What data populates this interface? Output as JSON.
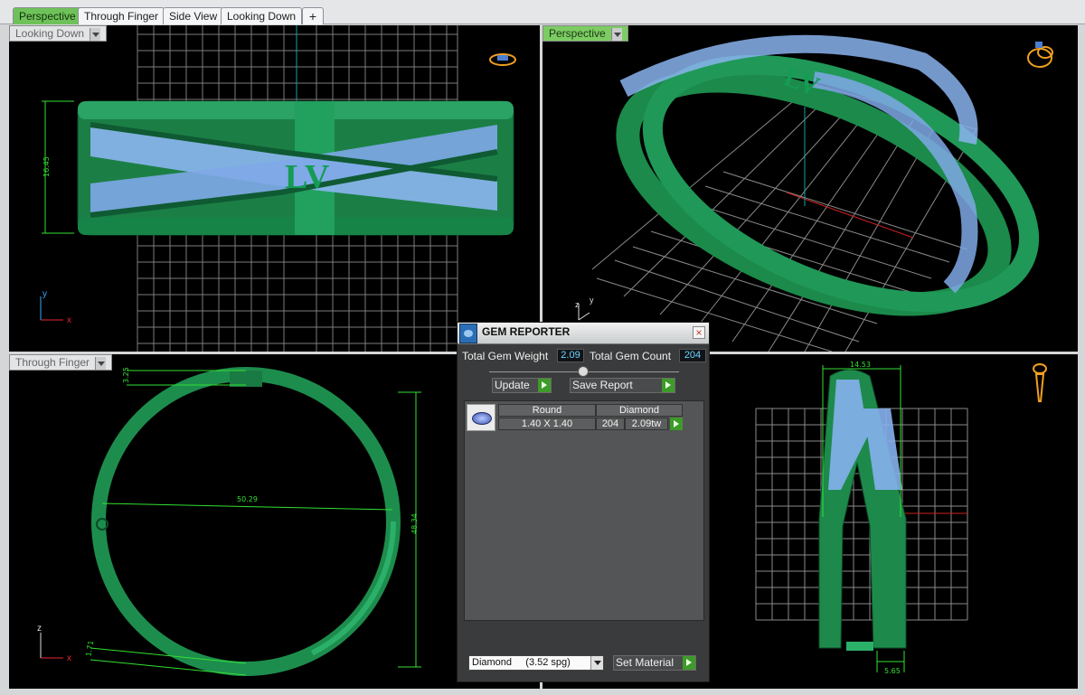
{
  "tabs": [
    {
      "label": "Perspective",
      "active": true
    },
    {
      "label": "Through Finger",
      "active": false
    },
    {
      "label": "Side View",
      "active": false
    },
    {
      "label": "Looking Down",
      "active": false
    }
  ],
  "add_tab_glyph": "+",
  "viewports": {
    "top_left": {
      "label": "Looking Down",
      "dimension": "16.45",
      "axis_x": "x",
      "axis_y": "y"
    },
    "top_right": {
      "label": "Perspective",
      "axis_z": "z",
      "axis_y": "y"
    },
    "bottom_left": {
      "label": "Through Finger",
      "dim_inner": "50.29",
      "dim_outer": "48.34",
      "dim_top": "3.25",
      "dim_bottom": "1.71",
      "axis_x": "x",
      "axis_z": "z"
    },
    "bottom_right": {
      "dim_top": "14.53",
      "dim_bottom": "5.65"
    }
  },
  "gem_reporter": {
    "title": "GEM REPORTER",
    "close_glyph": "×",
    "total_weight_label": "Total Gem Weight",
    "total_weight_value": "2.09",
    "total_count_label": "Total Gem Count",
    "total_count_value": "204",
    "update_label": "Update",
    "save_report_label": "Save Report",
    "table": {
      "headers": [
        "Round",
        "Diamond"
      ],
      "row": {
        "size": "1.40 X 1.40",
        "count": "204",
        "weight": "2.09tw"
      }
    },
    "material_select": "Diamond     (3.52 spg)",
    "set_material_label": "Set Material"
  },
  "colors": {
    "model": "#1e8a4c",
    "gems": "#8fb8f0",
    "dimension": "#33e033",
    "grid": "#8a8a8a"
  }
}
